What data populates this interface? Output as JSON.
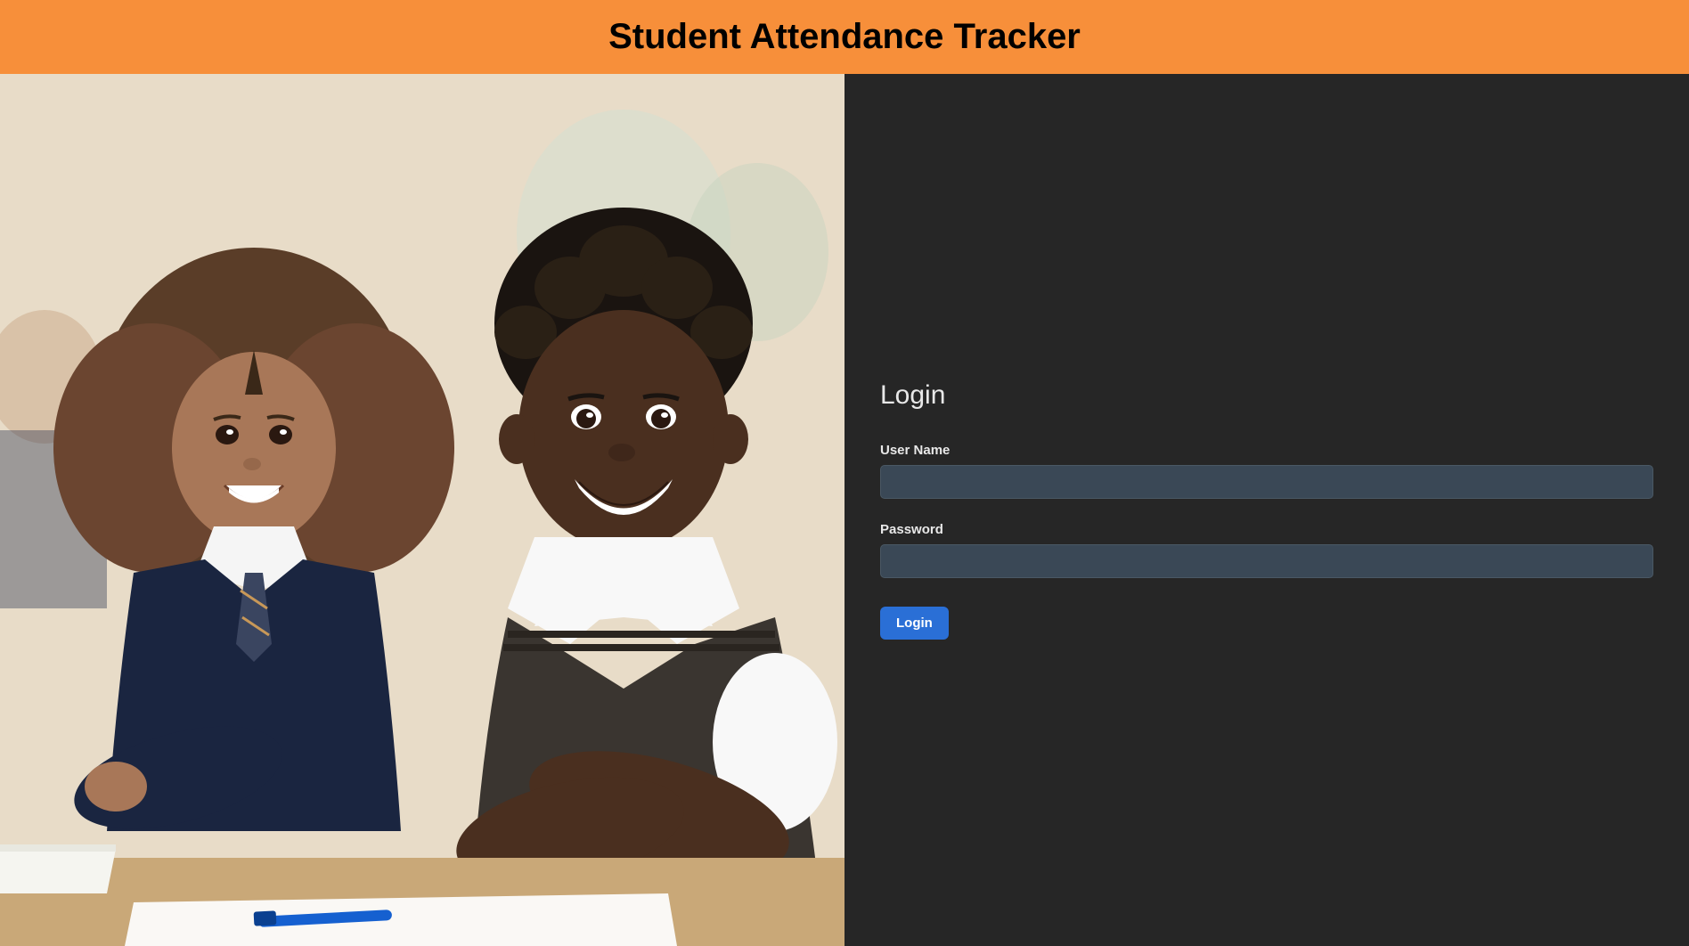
{
  "header": {
    "title": "Student Attendance Tracker"
  },
  "login": {
    "heading": "Login",
    "username_label": "User Name",
    "username_value": "",
    "password_label": "Password",
    "password_value": "",
    "button_label": "Login"
  },
  "colors": {
    "header_bg": "#f78f3a",
    "panel_bg": "#262626",
    "input_bg": "#3a4856",
    "button_bg": "#2a6fd6"
  }
}
